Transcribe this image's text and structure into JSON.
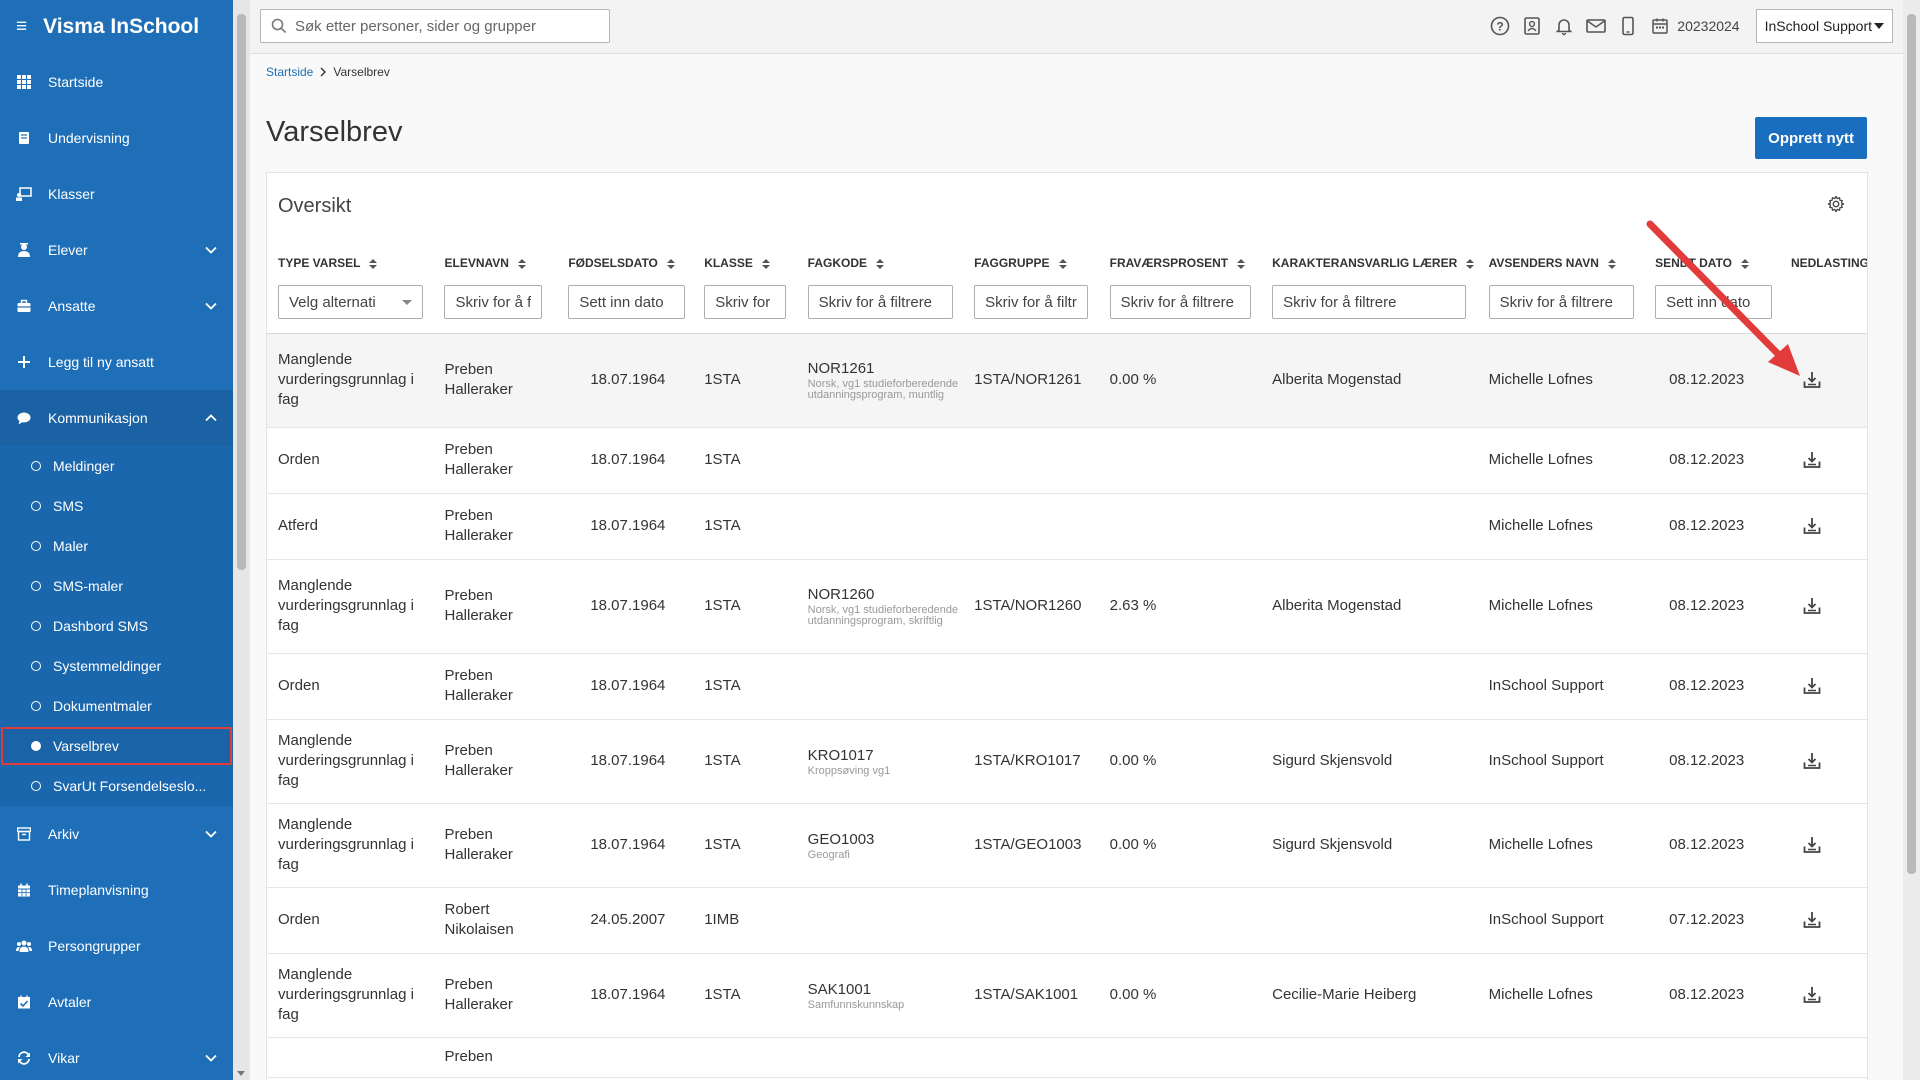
{
  "app": {
    "title": "Visma InSchool"
  },
  "sidebar": {
    "items": [
      {
        "label": "Startside",
        "icon": "grid-icon"
      },
      {
        "label": "Undervisning",
        "icon": "book-icon"
      },
      {
        "label": "Klasser",
        "icon": "classroom-icon"
      },
      {
        "label": "Elever",
        "icon": "student-icon",
        "expandable": true
      },
      {
        "label": "Ansatte",
        "icon": "briefcase-icon",
        "expandable": true
      },
      {
        "label": "Legg til ny ansatt",
        "icon": "plus-icon"
      },
      {
        "label": "Kommunikasjon",
        "icon": "chat-icon",
        "expanded": true
      }
    ],
    "sub_items": [
      {
        "label": "Meldinger"
      },
      {
        "label": "SMS"
      },
      {
        "label": "Maler"
      },
      {
        "label": "SMS-maler"
      },
      {
        "label": "Dashbord SMS"
      },
      {
        "label": "Systemmeldinger"
      },
      {
        "label": "Dokumentmaler"
      },
      {
        "label": "Varselbrev",
        "active": true
      },
      {
        "label": "SvarUt Forsendelseslo..."
      }
    ],
    "bottom_items": [
      {
        "label": "Arkiv",
        "icon": "archive-icon",
        "expandable": true
      },
      {
        "label": "Timeplanvisning",
        "icon": "calendar-icon"
      },
      {
        "label": "Persongrupper",
        "icon": "people-icon"
      },
      {
        "label": "Avtaler",
        "icon": "agreement-icon"
      },
      {
        "label": "Vikar",
        "icon": "swap-icon",
        "expandable": true
      }
    ]
  },
  "topbar": {
    "search_placeholder": "Søk etter personer, sider og grupper",
    "school_year": "20232024",
    "user": "InSchool Support"
  },
  "breadcrumb": {
    "home": "Startside",
    "current": "Varselbrev"
  },
  "page": {
    "title": "Varselbrev",
    "create_button": "Opprett nytt"
  },
  "card": {
    "title": "Oversikt"
  },
  "table": {
    "columns": [
      {
        "label": "TYPE VARSEL",
        "sortable": true,
        "filter_type": "select",
        "filter_placeholder": "Velg alternati"
      },
      {
        "label": "ELEVNAVN",
        "sortable": true,
        "filter_type": "text",
        "filter_placeholder": "Skriv for å filtrere"
      },
      {
        "label": "FØDSELSDATO",
        "sortable": true,
        "filter_type": "text",
        "filter_placeholder": "Sett inn dato"
      },
      {
        "label": "KLASSE",
        "sortable": true,
        "filter_type": "text",
        "filter_placeholder": "Skriv for å filtrere"
      },
      {
        "label": "FAGKODE",
        "sortable": true,
        "filter_type": "text",
        "filter_placeholder": "Skriv for å filtrere"
      },
      {
        "label": "FAGGRUPPE",
        "sortable": true,
        "filter_type": "text",
        "filter_placeholder": "Skriv for å filtrere"
      },
      {
        "label": "FRAVÆRSPROSENT",
        "sortable": true,
        "filter_type": "text",
        "filter_placeholder": "Skriv for å filtrere"
      },
      {
        "label": "KARAKTERANSVARLIG LÆRER",
        "sortable": true,
        "filter_type": "text",
        "filter_placeholder": "Skriv for å filtrere"
      },
      {
        "label": "AVSENDERS NAVN",
        "sortable": true,
        "filter_type": "text",
        "filter_placeholder": "Skriv for å filtrere"
      },
      {
        "label": "SENDT DATO",
        "sortable": true,
        "filter_type": "text",
        "filter_placeholder": "Sett inn dato"
      },
      {
        "label": "NEDLASTING",
        "sortable": false,
        "filter_type": "none"
      }
    ],
    "rows": [
      {
        "type": "Manglende vurderingsgrunnlag i fag",
        "name": "Preben Halleraker",
        "dob": "18.07.1964",
        "class": "1STA",
        "subject_code": "NOR1261",
        "subject_desc": "Norsk, vg1 studieforberedende utdanningsprogram, muntlig",
        "group": "1STA/NOR1261",
        "absence": "0.00 %",
        "teacher": "Alberita Mogenstad",
        "sender": "Michelle Lofnes",
        "sent": "08.12.2023"
      },
      {
        "type": "Orden",
        "name": "Preben Halleraker",
        "dob": "18.07.1964",
        "class": "1STA",
        "subject_code": "",
        "subject_desc": "",
        "group": "",
        "absence": "",
        "teacher": "",
        "sender": "Michelle Lofnes",
        "sent": "08.12.2023"
      },
      {
        "type": "Atferd",
        "name": "Preben Halleraker",
        "dob": "18.07.1964",
        "class": "1STA",
        "subject_code": "",
        "subject_desc": "",
        "group": "",
        "absence": "",
        "teacher": "",
        "sender": "Michelle Lofnes",
        "sent": "08.12.2023"
      },
      {
        "type": "Manglende vurderingsgrunnlag i fag",
        "name": "Preben Halleraker",
        "dob": "18.07.1964",
        "class": "1STA",
        "subject_code": "NOR1260",
        "subject_desc": "Norsk, vg1 studieforberedende utdanningsprogram, skriftlig",
        "group": "1STA/NOR1260",
        "absence": "2.63 %",
        "teacher": "Alberita Mogenstad",
        "sender": "Michelle Lofnes",
        "sent": "08.12.2023"
      },
      {
        "type": "Orden",
        "name": "Preben Halleraker",
        "dob": "18.07.1964",
        "class": "1STA",
        "subject_code": "",
        "subject_desc": "",
        "group": "",
        "absence": "",
        "teacher": "",
        "sender": "InSchool Support",
        "sent": "08.12.2023"
      },
      {
        "type": "Manglende vurderingsgrunnlag i fag",
        "name": "Preben Halleraker",
        "dob": "18.07.1964",
        "class": "1STA",
        "subject_code": "KRO1017",
        "subject_desc": "Kroppsøving vg1",
        "group": "1STA/KRO1017",
        "absence": "0.00 %",
        "teacher": "Sigurd Skjensvold",
        "sender": "InSchool Support",
        "sent": "08.12.2023"
      },
      {
        "type": "Manglende vurderingsgrunnlag i fag",
        "name": "Preben Halleraker",
        "dob": "18.07.1964",
        "class": "1STA",
        "subject_code": "GEO1003",
        "subject_desc": "Geografi",
        "group": "1STA/GEO1003",
        "absence": "0.00 %",
        "teacher": "Sigurd Skjensvold",
        "sender": "Michelle Lofnes",
        "sent": "08.12.2023"
      },
      {
        "type": "Orden",
        "name": "Robert Nikolaisen",
        "dob": "24.05.2007",
        "class": "1IMB",
        "subject_code": "",
        "subject_desc": "",
        "group": "",
        "absence": "",
        "teacher": "",
        "sender": "InSchool Support",
        "sent": "07.12.2023"
      },
      {
        "type": "Manglende vurderingsgrunnlag i fag",
        "name": "Preben Halleraker",
        "dob": "18.07.1964",
        "class": "1STA",
        "subject_code": "SAK1001",
        "subject_desc": "Samfunnskunnskap",
        "group": "1STA/SAK1001",
        "absence": "0.00 %",
        "teacher": "Cecilie-Marie Heiberg",
        "sender": "Michelle Lofnes",
        "sent": "08.12.2023"
      },
      {
        "type": "",
        "name": "Preben",
        "dob": "",
        "class": "",
        "subject_code": "",
        "subject_desc": "",
        "group": "",
        "absence": "",
        "teacher": "",
        "sender": "",
        "sent": ""
      }
    ]
  },
  "colors": {
    "sidebar_bg": "#1e6fb8",
    "primary": "#1a6ec0",
    "annotation": "#e23b3b"
  }
}
